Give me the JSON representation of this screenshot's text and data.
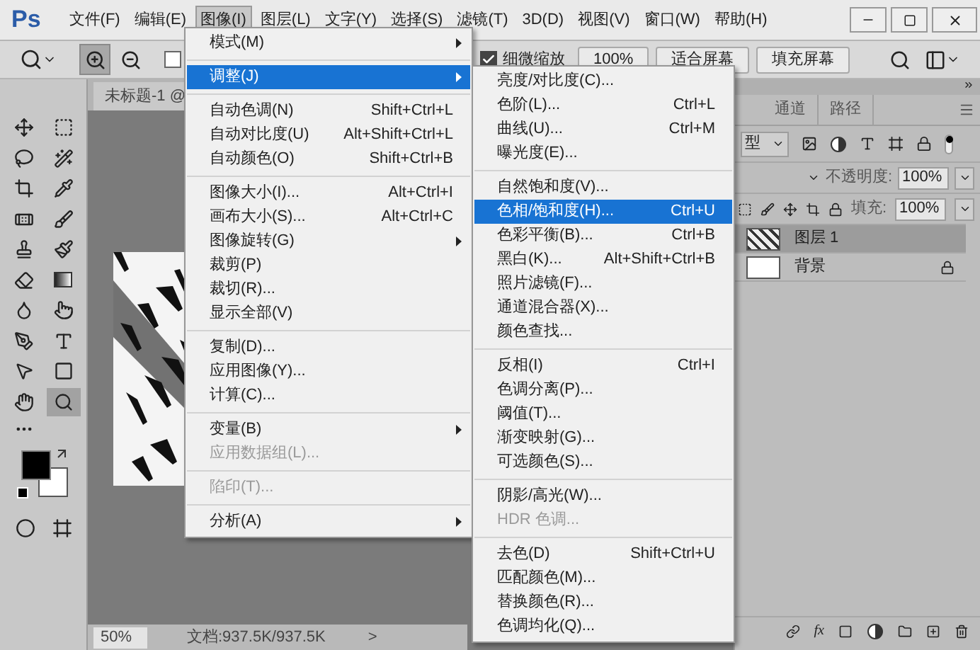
{
  "app_logo": "Ps",
  "menu_bar": [
    {
      "label": "文件(F)",
      "selected": false
    },
    {
      "label": "编辑(E)",
      "selected": false
    },
    {
      "label": "图像(I)",
      "selected": true
    },
    {
      "label": "图层(L)",
      "selected": false
    },
    {
      "label": "文字(Y)",
      "selected": false
    },
    {
      "label": "选择(S)",
      "selected": false
    },
    {
      "label": "滤镜(T)",
      "selected": false
    },
    {
      "label": "3D(D)",
      "selected": false
    },
    {
      "label": "视图(V)",
      "selected": false
    },
    {
      "label": "窗口(W)",
      "selected": false
    },
    {
      "label": "帮助(H)",
      "selected": false
    }
  ],
  "options_bar": {
    "zoom_buttons": [
      {
        "selected": true
      },
      {
        "selected": false
      }
    ],
    "resize_windows": {
      "checked": false
    },
    "scrubby_zoom": {
      "label": "细微缩放",
      "checked": true
    },
    "buttons": [
      "100%",
      "适合屏幕",
      "填充屏幕"
    ]
  },
  "toolbar": {
    "tools": [
      {
        "selected": false
      },
      {
        "selected": false
      },
      {
        "selected": false
      },
      {
        "selected": false
      },
      {
        "selected": false
      },
      {
        "selected": false
      },
      {
        "selected": false
      },
      {
        "selected": false
      },
      {
        "selected": false
      },
      {
        "selected": false
      },
      {
        "selected": false
      },
      {
        "selected": false
      },
      {
        "selected": false
      },
      {
        "selected": false
      },
      {
        "selected": false
      },
      {
        "selected": false
      },
      {
        "selected": false
      },
      {
        "selected": false
      },
      {
        "selected": false
      },
      {
        "selected": true
      }
    ]
  },
  "document": {
    "tab": "未标题-1 @",
    "zoom": "50%",
    "doc_info": "文档:937.5K/937.5K",
    "info_arrow": ">"
  },
  "image_menu": {
    "groups": [
      [
        {
          "label": "模式(M)",
          "submenu": true,
          "disabled": false,
          "selected": false
        }
      ],
      [
        {
          "label": "调整(J)",
          "submenu": true,
          "disabled": false,
          "selected": true
        }
      ],
      [
        {
          "label": "自动色调(N)",
          "shortcut": "Shift+Ctrl+L",
          "submenu": false,
          "disabled": false,
          "selected": false
        },
        {
          "label": "自动对比度(U)",
          "shortcut": "Alt+Shift+Ctrl+L",
          "submenu": false,
          "disabled": false,
          "selected": false
        },
        {
          "label": "自动颜色(O)",
          "shortcut": "Shift+Ctrl+B",
          "submenu": false,
          "disabled": false,
          "selected": false
        }
      ],
      [
        {
          "label": "图像大小(I)...",
          "shortcut": "Alt+Ctrl+I",
          "submenu": false,
          "disabled": false,
          "selected": false
        },
        {
          "label": "画布大小(S)...",
          "shortcut": "Alt+Ctrl+C",
          "submenu": false,
          "disabled": false,
          "selected": false
        },
        {
          "label": "图像旋转(G)",
          "submenu": true,
          "disabled": false,
          "selected": false
        },
        {
          "label": "裁剪(P)",
          "submenu": false,
          "disabled": false,
          "selected": false
        },
        {
          "label": "裁切(R)...",
          "submenu": false,
          "disabled": false,
          "selected": false
        },
        {
          "label": "显示全部(V)",
          "submenu": false,
          "disabled": false,
          "selected": false
        }
      ],
      [
        {
          "label": "复制(D)...",
          "submenu": false,
          "disabled": false,
          "selected": false
        },
        {
          "label": "应用图像(Y)...",
          "submenu": false,
          "disabled": false,
          "selected": false
        },
        {
          "label": "计算(C)...",
          "submenu": false,
          "disabled": false,
          "selected": false
        }
      ],
      [
        {
          "label": "变量(B)",
          "submenu": true,
          "disabled": false,
          "selected": false
        },
        {
          "label": "应用数据组(L)...",
          "submenu": false,
          "disabled": true,
          "selected": false
        }
      ],
      [
        {
          "label": "陷印(T)...",
          "submenu": false,
          "disabled": true,
          "selected": false
        }
      ],
      [
        {
          "label": "分析(A)",
          "submenu": true,
          "disabled": false,
          "selected": false
        }
      ]
    ]
  },
  "adjust_submenu": {
    "groups": [
      [
        {
          "label": "亮度/对比度(C)...",
          "submenu": false,
          "disabled": false,
          "selected": false
        },
        {
          "label": "色阶(L)...",
          "shortcut": "Ctrl+L",
          "submenu": false,
          "disabled": false,
          "selected": false
        },
        {
          "label": "曲线(U)...",
          "shortcut": "Ctrl+M",
          "submenu": false,
          "disabled": false,
          "selected": false
        },
        {
          "label": "曝光度(E)...",
          "submenu": false,
          "disabled": false,
          "selected": false
        }
      ],
      [
        {
          "label": "自然饱和度(V)...",
          "submenu": false,
          "disabled": false,
          "selected": false
        },
        {
          "label": "色相/饱和度(H)...",
          "shortcut": "Ctrl+U",
          "submenu": false,
          "disabled": false,
          "selected": true
        },
        {
          "label": "色彩平衡(B)...",
          "shortcut": "Ctrl+B",
          "submenu": false,
          "disabled": false,
          "selected": false
        },
        {
          "label": "黑白(K)...",
          "shortcut": "Alt+Shift+Ctrl+B",
          "submenu": false,
          "disabled": false,
          "selected": false
        },
        {
          "label": "照片滤镜(F)...",
          "submenu": false,
          "disabled": false,
          "selected": false
        },
        {
          "label": "通道混合器(X)...",
          "submenu": false,
          "disabled": false,
          "selected": false
        },
        {
          "label": "颜色查找...",
          "submenu": false,
          "disabled": false,
          "selected": false
        }
      ],
      [
        {
          "label": "反相(I)",
          "shortcut": "Ctrl+I",
          "submenu": false,
          "disabled": false,
          "selected": false
        },
        {
          "label": "色调分离(P)...",
          "submenu": false,
          "disabled": false,
          "selected": false
        },
        {
          "label": "阈值(T)...",
          "submenu": false,
          "disabled": false,
          "selected": false
        },
        {
          "label": "渐变映射(G)...",
          "submenu": false,
          "disabled": false,
          "selected": false
        },
        {
          "label": "可选颜色(S)...",
          "submenu": false,
          "disabled": false,
          "selected": false
        }
      ],
      [
        {
          "label": "阴影/高光(W)...",
          "submenu": false,
          "disabled": false,
          "selected": false
        },
        {
          "label": "HDR 色调...",
          "submenu": false,
          "disabled": true,
          "selected": false
        }
      ],
      [
        {
          "label": "去色(D)",
          "shortcut": "Shift+Ctrl+U",
          "submenu": false,
          "disabled": false,
          "selected": false
        },
        {
          "label": "匹配颜色(M)...",
          "submenu": false,
          "disabled": false,
          "selected": false
        },
        {
          "label": "替换颜色(R)...",
          "submenu": false,
          "disabled": false,
          "selected": false
        },
        {
          "label": "色调均化(Q)...",
          "submenu": false,
          "disabled": false,
          "selected": false
        }
      ]
    ]
  },
  "layers_panel": {
    "tabs": [
      {
        "label": "通道",
        "selected": false
      },
      {
        "label": "路径",
        "selected": false
      }
    ],
    "filter_kind": "型",
    "opacity_label": "不透明度:",
    "opacity": "100%",
    "fill_label": "填充:",
    "fill": "100%",
    "fx": "fx",
    "layers": [
      {
        "name": "图层 1",
        "selected": true,
        "locked": false,
        "kind": "pixel"
      },
      {
        "name": "背景",
        "selected": false,
        "locked": true,
        "kind": "background"
      }
    ]
  }
}
